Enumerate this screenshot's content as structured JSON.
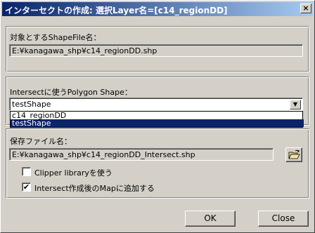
{
  "window": {
    "title": "インターセクトの作成: 選択Layer名=[c14_regionDD]",
    "close_glyph": "×"
  },
  "shapefile": {
    "label": "対象とするShapeFile名：",
    "value": "E:¥kanagawa_shp¥c14_regionDD.shp"
  },
  "intersect": {
    "label": "Intersectに使うPolygon Shape：",
    "selected": "testShape",
    "options": [
      "c14_regionDD",
      "testShape"
    ],
    "highlighted_index": 1
  },
  "save": {
    "label": "保存ファイル名：",
    "value": "E:¥kanagawa_shp¥c14_regionDD_Intersect.shp",
    "browse_icon": "open-folder-icon"
  },
  "options": {
    "clipper": {
      "label": "Clipper libraryを使う",
      "checked": false
    },
    "add_map": {
      "label": "Intersect作成後のMapに追加する",
      "checked": true
    }
  },
  "buttons": {
    "ok": "OK",
    "close": "Close"
  },
  "colors": {
    "title_start": "#0a246a",
    "title_end": "#a6caf0",
    "face": "#d4d0c8",
    "highlight": "#0a246a"
  }
}
